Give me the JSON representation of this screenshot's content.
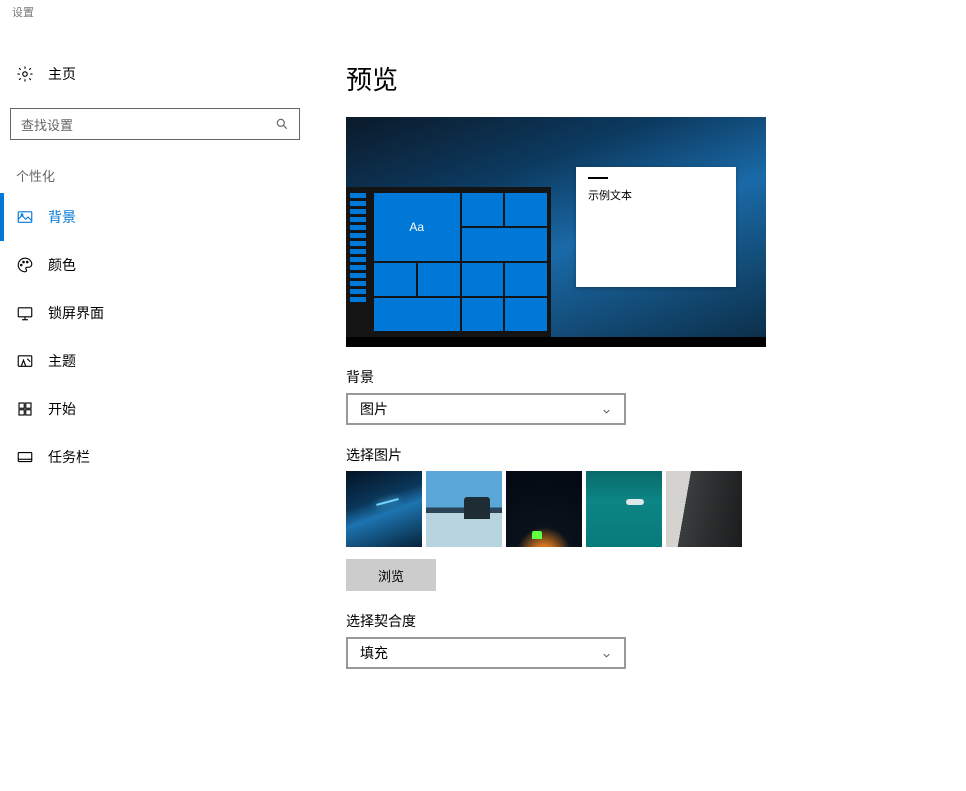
{
  "app_title": "设置",
  "sidebar": {
    "home_label": "主页",
    "search_placeholder": "查找设置",
    "section_label": "个性化",
    "items": [
      {
        "label": "背景"
      },
      {
        "label": "颜色"
      },
      {
        "label": "锁屏界面"
      },
      {
        "label": "主题"
      },
      {
        "label": "开始"
      },
      {
        "label": "任务栏"
      }
    ]
  },
  "main": {
    "heading": "预览",
    "preview_sample_text": "示例文本",
    "preview_tile_text": "Aa",
    "bg_label": "背景",
    "bg_value": "图片",
    "choose_label": "选择图片",
    "browse_label": "浏览",
    "fit_label": "选择契合度",
    "fit_value": "填充"
  }
}
